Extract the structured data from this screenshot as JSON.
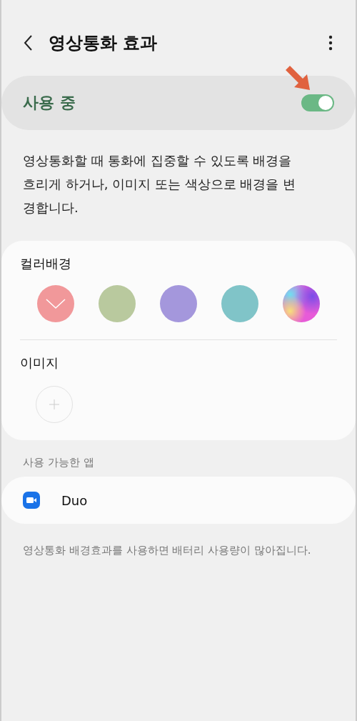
{
  "header": {
    "title": "영상통화 효과"
  },
  "master_switch": {
    "label": "사용 중",
    "on": true
  },
  "description": "영상통화할 때 통화에 집중할 수 있도록 배경을 흐리게 하거나, 이미지 또는 색상으로 배경을 변경합니다.",
  "color_background": {
    "title": "컬러배경",
    "swatches": [
      {
        "kind": "solid",
        "color": "#f1989a",
        "selected": true
      },
      {
        "kind": "solid",
        "color": "#b9c99e",
        "selected": false
      },
      {
        "kind": "solid",
        "color": "#a497dc",
        "selected": false
      },
      {
        "kind": "solid",
        "color": "#80c4c8",
        "selected": false
      },
      {
        "kind": "gradient",
        "selected": false
      }
    ]
  },
  "image": {
    "title": "이미지"
  },
  "available_apps": {
    "title": "사용 가능한 앱",
    "apps": [
      {
        "name": "Duo"
      }
    ]
  },
  "footnote": "영상통화 배경효과를 사용하면 배터리 사용량이 많아집니다."
}
